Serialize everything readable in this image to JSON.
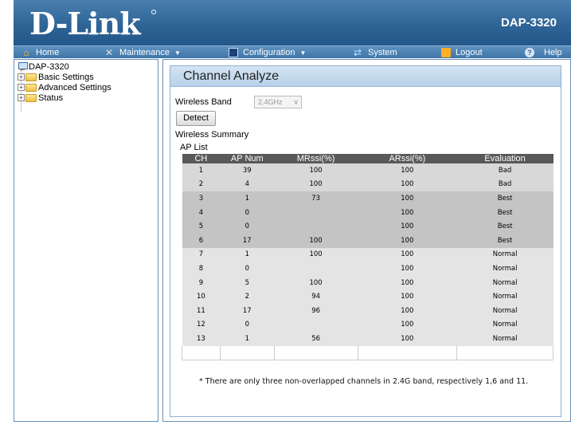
{
  "header": {
    "logo_text": "D-Link",
    "model": "DAP-3320"
  },
  "menu": {
    "home": "Home",
    "maintenance": "Maintenance",
    "configuration": "Configuration",
    "system": "System",
    "logout": "Logout",
    "help": "Help"
  },
  "tree": {
    "root": "DAP-3320",
    "items": [
      {
        "label": "Basic Settings"
      },
      {
        "label": "Advanced Settings"
      },
      {
        "label": "Status"
      }
    ]
  },
  "page": {
    "title": "Channel Analyze",
    "wireless_band_label": "Wireless Band",
    "wireless_band_value": "2.4GHz",
    "detect_label": "Detect",
    "summary_label": "Wireless Summary",
    "ap_list_label": "AP List",
    "columns": [
      "CH",
      "AP Num",
      "MRssi(%)",
      "ARssi(%)",
      "Evaluation"
    ],
    "rows": [
      {
        "ch": "1",
        "ap": "39",
        "mr": "100",
        "ar": "100",
        "ev": "Bad"
      },
      {
        "ch": "2",
        "ap": "4",
        "mr": "100",
        "ar": "100",
        "ev": "Bad"
      },
      {
        "ch": "3",
        "ap": "1",
        "mr": "73",
        "ar": "100",
        "ev": "Best"
      },
      {
        "ch": "4",
        "ap": "0",
        "mr": "",
        "ar": "100",
        "ev": "Best"
      },
      {
        "ch": "5",
        "ap": "0",
        "mr": "",
        "ar": "100",
        "ev": "Best"
      },
      {
        "ch": "6",
        "ap": "17",
        "mr": "100",
        "ar": "100",
        "ev": "Best"
      },
      {
        "ch": "7",
        "ap": "1",
        "mr": "100",
        "ar": "100",
        "ev": "Normal"
      },
      {
        "ch": "8",
        "ap": "0",
        "mr": "",
        "ar": "100",
        "ev": "Normal"
      },
      {
        "ch": "9",
        "ap": "5",
        "mr": "100",
        "ar": "100",
        "ev": "Normal"
      },
      {
        "ch": "10",
        "ap": "2",
        "mr": "94",
        "ar": "100",
        "ev": "Normal"
      },
      {
        "ch": "11",
        "ap": "17",
        "mr": "96",
        "ar": "100",
        "ev": "Normal"
      },
      {
        "ch": "12",
        "ap": "0",
        "mr": "",
        "ar": "100",
        "ev": "Normal"
      },
      {
        "ch": "13",
        "ap": "1",
        "mr": "56",
        "ar": "100",
        "ev": "Normal"
      }
    ],
    "footnote": "* There are only three non-overlapped channels in 2.4G band, respectively 1,6 and 11."
  }
}
